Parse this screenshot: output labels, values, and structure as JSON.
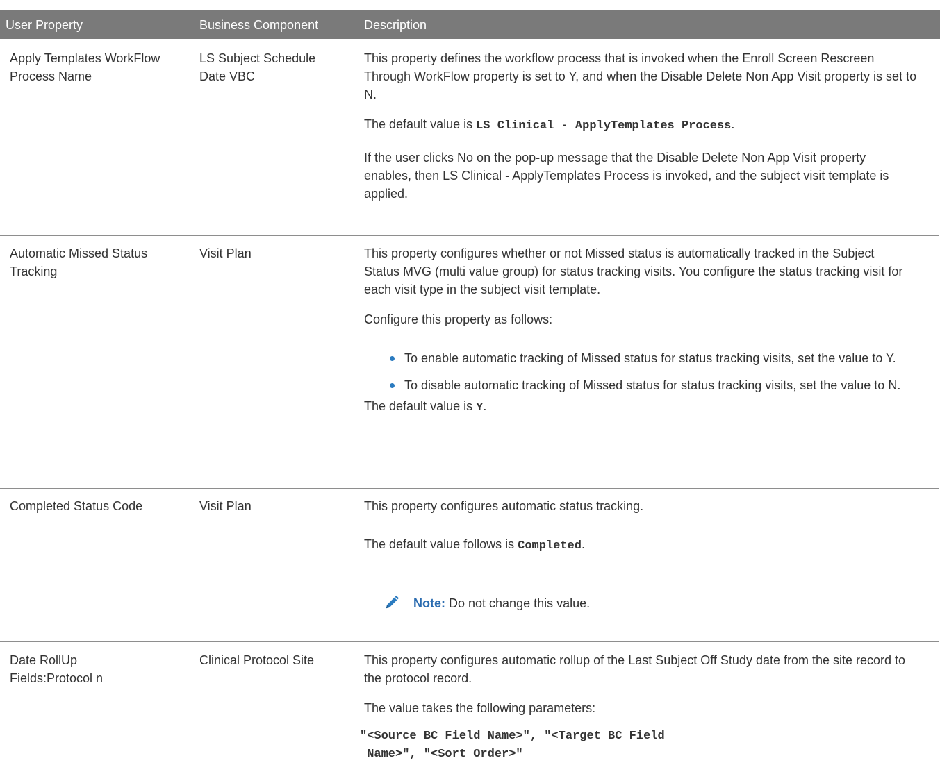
{
  "header": {
    "col1": "User Property",
    "col2": "Business Component",
    "col3": "Description"
  },
  "rows": [
    {
      "property": "Apply Templates WorkFlow Process Name",
      "bc": "LS Subject Schedule Date VBC",
      "p1": "This property defines the workflow process that is invoked when the Enroll Screen Rescreen Through WorkFlow property is set to Y, and when the Disable Delete Non App Visit property is set to N.",
      "default_prefix": "The default value is ",
      "default_value": "LS Clinical - ApplyTemplates Process",
      "default_suffix": ".",
      "p3": "If the user clicks No on the pop-up message that the Disable Delete Non App Visit property enables, then LS Clinical - ApplyTemplates Process is invoked, and the subject visit template is applied."
    },
    {
      "property": "Automatic Missed Status Tracking",
      "bc": "Visit Plan",
      "p1": "This property configures whether or not Missed status is automatically tracked in the Subject Status MVG (multi value group) for status tracking visits. You configure the status tracking visit for each visit type in the subject visit template.",
      "p2": "Configure this property as follows:",
      "bullets": [
        "To enable automatic tracking of Missed status for status tracking visits, set the value to Y.",
        "To disable automatic tracking of Missed status for status tracking visits, set the value to N."
      ],
      "default_prefix": "The default value is ",
      "default_value": "Y",
      "default_suffix": "."
    },
    {
      "property": "Completed Status Code",
      "bc": "Visit Plan",
      "p1": "This property configures automatic status tracking.",
      "default_prefix": "The default value follows is ",
      "default_value": "Completed",
      "default_suffix": ".",
      "note_label": "Note:",
      "note_text": "Do not change this value.",
      "note_icon": "pencil-icon"
    },
    {
      "property": "Date RollUp Fields:Protocol n",
      "bc": "Clinical Protocol Site",
      "p1": "This property configures automatic rollup of the Last Subject Off Study date from the site record to the protocol record.",
      "p2": "The value takes the following parameters:",
      "code": "\"<Source BC Field Name>\", \"<Target BC Field\n Name>\", \"<Sort Order>\""
    }
  ],
  "colors": {
    "header_bg": "#7a7a7a",
    "header_text": "#ffffff",
    "body_text": "#333333",
    "accent": "#2b7bc0",
    "divider": "#8e8e8e"
  }
}
